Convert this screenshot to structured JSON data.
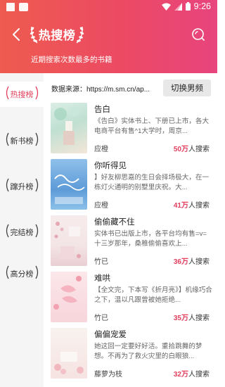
{
  "status_bar": {
    "time": "9:26"
  },
  "header": {
    "title": "热搜榜",
    "subtitle": "近期搜索次数最多的书籍"
  },
  "sidebar": {
    "items": [
      {
        "label": "热搜榜",
        "active": true
      },
      {
        "label": "新书榜",
        "active": false
      },
      {
        "label": "蹿升榜",
        "active": false
      },
      {
        "label": "完结榜",
        "active": false
      },
      {
        "label": "高分榜",
        "active": false
      }
    ]
  },
  "source": {
    "text": "数据来源：https://m.sm.cn/ap..."
  },
  "switch_button": {
    "label": "切换男频"
  },
  "books": [
    {
      "title": "告白",
      "desc": "《告白》实体书上、下册已上市，各大电商平台有售^1大学时，周京...",
      "author": "应橙",
      "count": "50万",
      "unit": "人搜索"
    },
    {
      "title": "你听得见",
      "desc": "】好友柳思嘉的生日会择场极大，在一栋灯火通明的别墅里庆祝。大...",
      "author": "应橙",
      "count": "41万",
      "unit": "人搜索"
    },
    {
      "title": "偷偷藏不住",
      "desc": "实体书已出版上市，各平台均有售=v=十三岁那年，桑稚偷偷喜欢上...",
      "author": "竹已",
      "count": "36万",
      "unit": "人搜索"
    },
    {
      "title": "难哄",
      "desc": "【全文完，下本写《折月亮》】机缘巧合之下，温以凡跟曾被她拒绝...",
      "author": "竹已",
      "count": "35万",
      "unit": "人搜索"
    },
    {
      "title": "偏偏宠爱",
      "desc": "她这回一定要好好活。重拾跳舞的梦想。不再为了救火灾里的白眼狼...",
      "author": "藤萝为枝",
      "count": "32万",
      "unit": "人搜索"
    }
  ],
  "colors": {
    "accent": "#e2405e",
    "header_start": "#ee5b4f",
    "header_end": "#e8447e"
  }
}
